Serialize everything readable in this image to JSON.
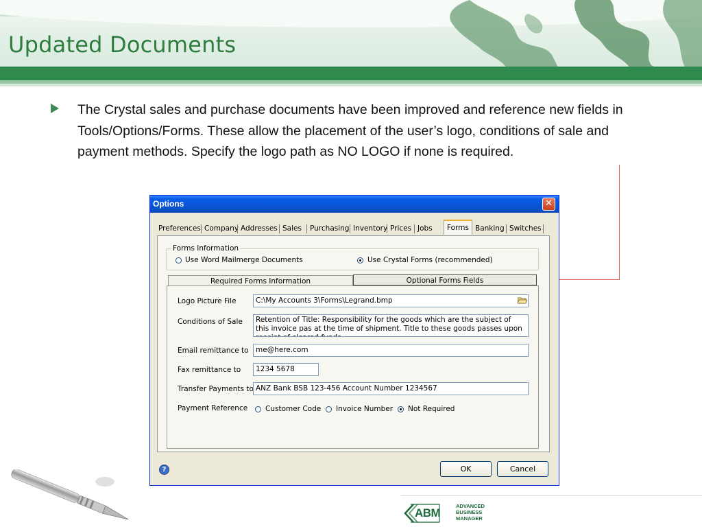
{
  "slide": {
    "title": "Updated Documents",
    "bullet": "The Crystal sales and purchase documents have been improved and reference new fields in Tools/Options/Forms. These allow the placement of the user’s logo, conditions of sale and payment methods. Specify the logo path as NO LOGO if none is required."
  },
  "dialog": {
    "title": "Options",
    "close_glyph": "✕",
    "tabs": [
      {
        "label": "Preferences"
      },
      {
        "label": "Company"
      },
      {
        "label": "Addresses"
      },
      {
        "label": "Sales"
      },
      {
        "label": "Purchasing"
      },
      {
        "label": "Inventory"
      },
      {
        "label": "Prices"
      },
      {
        "label": "Jobs"
      },
      {
        "label": "Forms",
        "selected": true
      },
      {
        "label": "Banking"
      },
      {
        "label": "Switches"
      }
    ],
    "forms_information": {
      "label": "Forms Information",
      "option_word": "Use Word Mailmerge Documents",
      "option_crystal": "Use Crystal Forms (recommended)",
      "selected": "crystal"
    },
    "subtabs": {
      "required": "Required Forms Information",
      "optional": "Optional Forms Fields",
      "active": "optional"
    },
    "fields": {
      "logo_label": "Logo Picture File",
      "logo_value": "C:\\My Accounts 3\\Forms\\Legrand.bmp",
      "conditions_label": "Conditions of Sale",
      "conditions_value": "Retention of Title: Responsibility for the goods which are the subject of this invoice pas at the time of shipment. Title to these goods passes upon receipt of cleared funds.",
      "email_label": "Email remittance to",
      "email_value": "me@here.com",
      "fax_label": "Fax remittance to",
      "fax_value": "1234 5678",
      "transfer_label": "Transfer Payments to",
      "transfer_value": "ANZ Bank BSB 123-456 Account Number 1234567",
      "payref_label": "Payment Reference",
      "payref_options": [
        "Customer Code",
        "Invoice Number",
        "Not Required"
      ],
      "payref_selected": "Not Required"
    },
    "buttons": {
      "ok": "OK",
      "cancel": "Cancel",
      "help": "?"
    }
  },
  "footer": {
    "logo_text": "ABM",
    "tagline_1": "ADVANCED",
    "tagline_2": "BUSINESS",
    "tagline_3": "MANAGER"
  },
  "colors": {
    "title_green": "#2e7d3e",
    "header_bar_green": "#2f8a4e",
    "xp_title_blue": "#0b57d9",
    "connector_red": "#e06060"
  }
}
